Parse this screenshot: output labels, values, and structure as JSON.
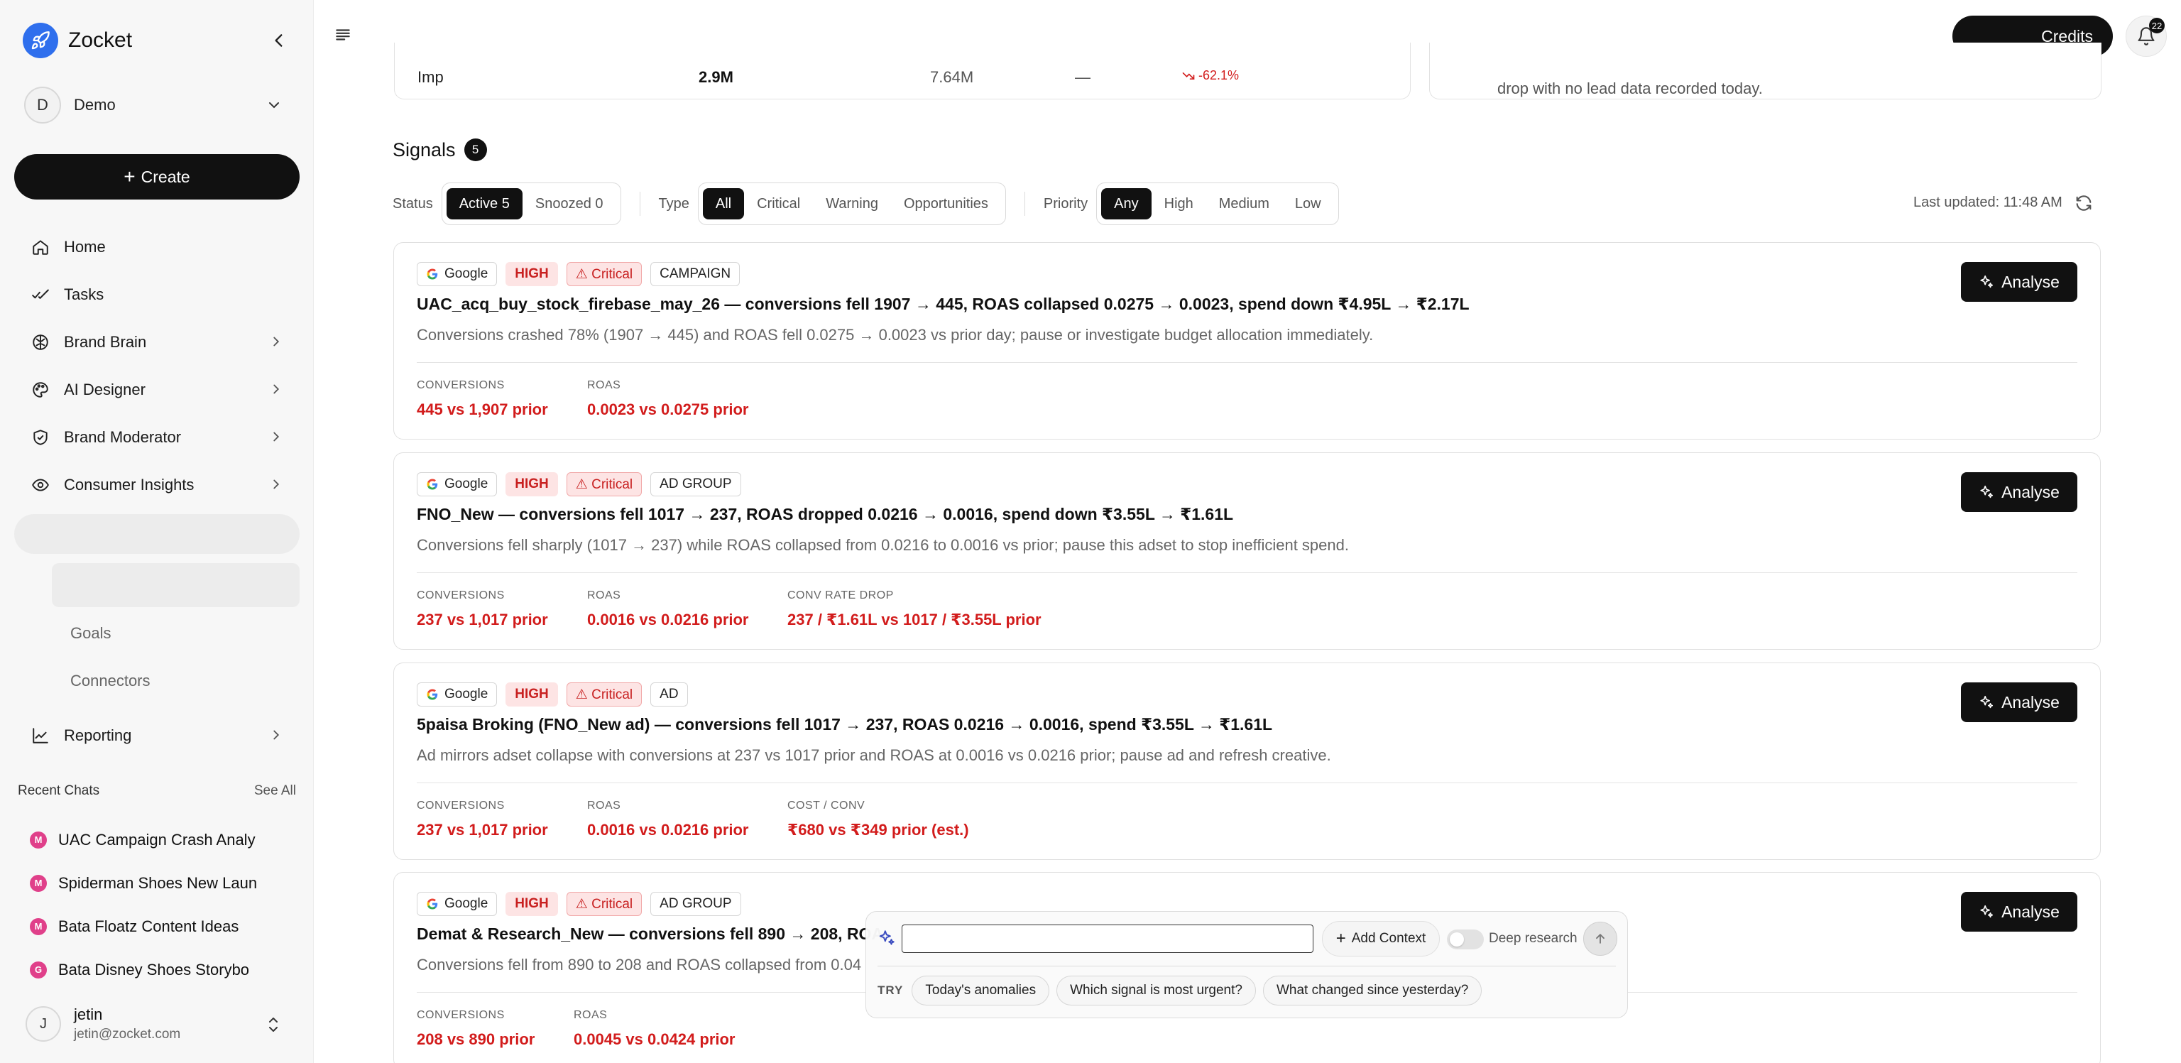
{
  "app": {
    "name": "Zocket"
  },
  "workspace": {
    "initial": "D",
    "name": "Demo"
  },
  "sidebar": {
    "create_label": "Create",
    "items": [
      {
        "label": "Home",
        "icon": "home-icon"
      },
      {
        "label": "Tasks",
        "icon": "tasks-icon"
      },
      {
        "label": "Brand Brain",
        "icon": "brain-icon"
      },
      {
        "label": "AI Designer",
        "icon": "palette-icon"
      },
      {
        "label": "Brand Moderator",
        "icon": "shield-icon"
      },
      {
        "label": "Consumer Insights",
        "icon": "eye-icon"
      }
    ],
    "sub_items": [
      "Goals",
      "Connectors"
    ],
    "reporting_label": "Reporting",
    "recent": {
      "title": "Recent Chats",
      "see_all": "See All",
      "items": [
        {
          "badge": "M",
          "label": "UAC Campaign Crash Analy"
        },
        {
          "badge": "M",
          "label": "Spiderman Shoes New Laun"
        },
        {
          "badge": "M",
          "label": "Bata Floatz Content Ideas"
        },
        {
          "badge": "G",
          "label": "Bata Disney Shoes Storybo"
        }
      ]
    },
    "user": {
      "initial": "J",
      "name": "jetin",
      "email": "jetin@zocket.com"
    }
  },
  "topbar": {
    "credits_label": "Credits",
    "notifications_count": "22"
  },
  "top_card": {
    "metric": "Imp",
    "current": "2.9M",
    "prior": "7.64M",
    "dash": "—",
    "change": "-62.1%",
    "note": "drop with no lead data recorded today."
  },
  "signals": {
    "title": "Signals",
    "count": "5",
    "filters": {
      "status_label": "Status",
      "status_options": [
        "Active 5",
        "Snoozed 0"
      ],
      "type_label": "Type",
      "type_options": [
        "All",
        "Critical",
        "Warning",
        "Opportunities"
      ],
      "priority_label": "Priority",
      "priority_options": [
        "Any",
        "High",
        "Medium",
        "Low"
      ]
    },
    "last_updated": "Last updated: 11:48 AM",
    "analyse_label": "Analyse",
    "cards": [
      {
        "platform": "Google",
        "priority": "HIGH",
        "severity": "⚠ Critical",
        "level": "CAMPAIGN",
        "title": "UAC_acq_buy_stock_firebase_may_26 — conversions fell 1907 → 445, ROAS collapsed 0.0275 → 0.0023, spend down ₹4.95L → ₹2.17L",
        "desc": "Conversions crashed 78% (1907 → 445) and ROAS fell 0.0275 → 0.0023 vs prior day; pause or investigate budget allocation immediately.",
        "metrics": [
          {
            "label": "CONVERSIONS",
            "value": "445 vs 1,907 prior"
          },
          {
            "label": "ROAS",
            "value": "0.0023 vs 0.0275 prior"
          }
        ]
      },
      {
        "platform": "Google",
        "priority": "HIGH",
        "severity": "⚠ Critical",
        "level": "AD GROUP",
        "title": "FNO_New — conversions fell 1017 → 237, ROAS dropped 0.0216 → 0.0016, spend down ₹3.55L → ₹1.61L",
        "desc": "Conversions fell sharply (1017 → 237) while ROAS collapsed from 0.0216 to 0.0016 vs prior; pause this adset to stop inefficient spend.",
        "metrics": [
          {
            "label": "CONVERSIONS",
            "value": "237 vs 1,017 prior"
          },
          {
            "label": "ROAS",
            "value": "0.0016 vs 0.0216 prior"
          },
          {
            "label": "CONV RATE DROP",
            "value": "237 / ₹1.61L vs 1017 / ₹3.55L prior"
          }
        ]
      },
      {
        "platform": "Google",
        "priority": "HIGH",
        "severity": "⚠ Critical",
        "level": "AD",
        "title": "5paisa Broking (FNO_New ad) — conversions fell 1017 → 237, ROAS 0.0216 → 0.0016, spend ₹3.55L → ₹1.61L",
        "desc": "Ad mirrors adset collapse with conversions at 237 vs 1017 prior and ROAS at 0.0016 vs 0.0216 prior; pause ad and refresh creative.",
        "metrics": [
          {
            "label": "CONVERSIONS",
            "value": "237 vs 1,017 prior"
          },
          {
            "label": "ROAS",
            "value": "0.0016 vs 0.0216 prior"
          },
          {
            "label": "COST / CONV",
            "value": "₹680 vs ₹349 prior (est.)"
          }
        ]
      },
      {
        "platform": "Google",
        "priority": "HIGH",
        "severity": "⚠ Critical",
        "level": "AD GROUP",
        "title": "Demat & Research_New — conversions fell 890 → 208, ROA",
        "desc": "Conversions fell from 890 to 208 and ROAS collapsed from 0.04",
        "metrics": [
          {
            "label": "CONVERSIONS",
            "value": "208 vs 890 prior"
          },
          {
            "label": "ROAS",
            "value": "0.0045 vs 0.0424 prior"
          }
        ]
      }
    ]
  },
  "chat": {
    "add_context": "Add Context",
    "deep_research": "Deep research",
    "try_label": "TRY",
    "suggestions": [
      "Today's anomalies",
      "Which signal is most urgent?",
      "What changed since yesterday?"
    ]
  },
  "colors": {
    "accent": "#111111",
    "critical": "#d21c1c",
    "brand_blue": "#2f6fed",
    "badge_pink": "#e0408a"
  }
}
